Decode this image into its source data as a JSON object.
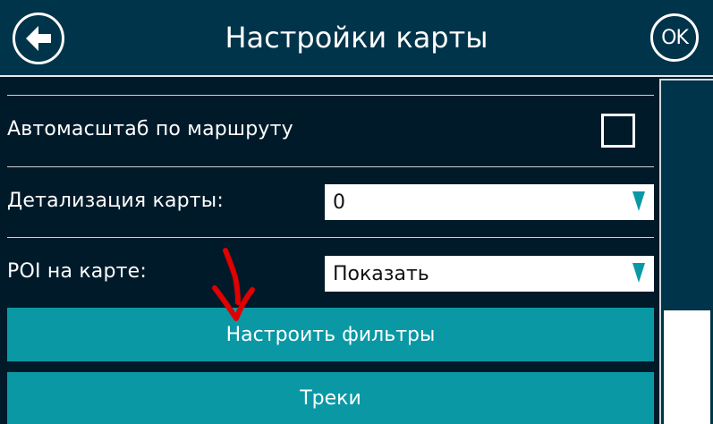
{
  "header": {
    "title": "Настройки карты",
    "ok_label": "OK",
    "back_icon": "back-arrow-icon"
  },
  "settings": {
    "autoscale_label": "Автомасштаб по маршруту",
    "autoscale_checked": false,
    "detail_label": "Детализация карты:",
    "detail_value": "0",
    "poi_label": "POI на карте:",
    "poi_value": "Показать"
  },
  "buttons": {
    "filters_label": "Настроить фильтры",
    "tracks_label": "Треки"
  },
  "colors": {
    "header_bg": "#00344a",
    "content_bg": "#001a2a",
    "button_bg": "#0a98a5",
    "dropdown_arrow": "#0a98a5",
    "annotation": "#e00000"
  }
}
